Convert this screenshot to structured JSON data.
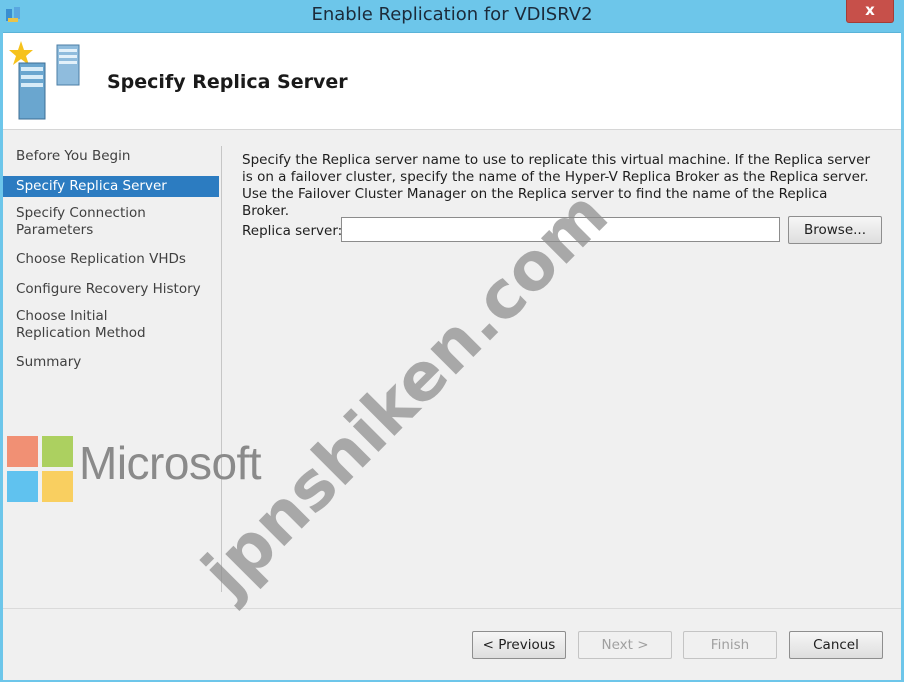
{
  "window": {
    "title": "Enable Replication for VDISRV2",
    "close_label": "x"
  },
  "header": {
    "title": "Specify Replica Server",
    "icon": "replica-server-icon"
  },
  "nav": {
    "items": [
      {
        "label": "Before You Begin",
        "selected": false
      },
      {
        "label": "Specify Replica Server",
        "selected": true
      },
      {
        "label": "Specify Connection Parameters",
        "selected": false
      },
      {
        "label": "Choose Replication VHDs",
        "selected": false
      },
      {
        "label": "Configure Recovery History",
        "selected": false
      },
      {
        "label": "Choose Initial Replication Method",
        "selected": false
      },
      {
        "label": "Summary",
        "selected": false
      }
    ]
  },
  "main": {
    "description": "Specify the Replica server name to use to replicate this virtual machine. If the Replica server is on a failover cluster, specify the name of the Hyper-V Replica Broker as the Replica server. Use the Failover Cluster Manager on the Replica server to find the name of the Replica Broker.",
    "replica_server_label": "Replica server:",
    "replica_server_value": "",
    "browse_label": "Browse..."
  },
  "footer": {
    "previous_label": "< Previous",
    "next_label": "Next >",
    "finish_label": "Finish",
    "cancel_label": "Cancel"
  },
  "overlay": {
    "microsoft_text": "Microsoft",
    "watermark_text": "jpnshiken.com"
  },
  "colors": {
    "titlebar": "#6dc6ea",
    "selected_nav": "#2c7cc1",
    "close_button": "#c7504a",
    "ms_red": "#f25022",
    "ms_green": "#7fba00",
    "ms_blue": "#00a4ef",
    "ms_yellow": "#ffb900"
  }
}
